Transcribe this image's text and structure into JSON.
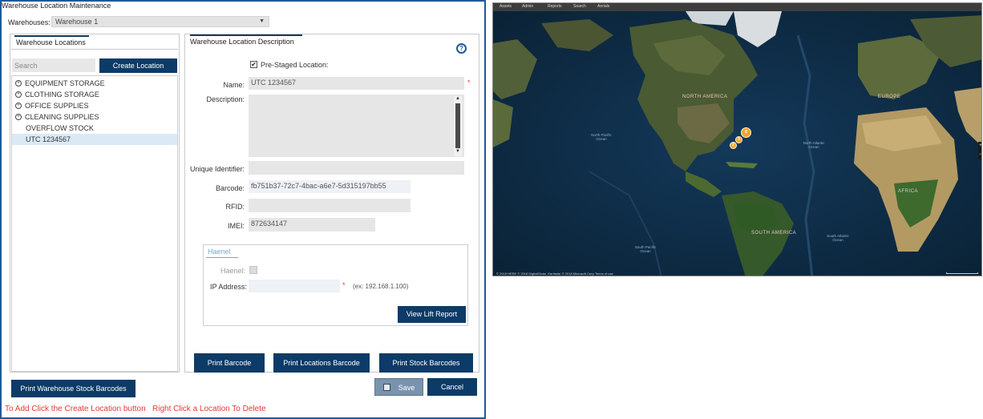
{
  "dialog": {
    "title": "Warehouse Location Maintenance",
    "warehouses_label": "Warehouses:",
    "warehouse_selected": "Warehouse 1",
    "left_tab": "Warehouse Locations",
    "search_placeholder": "Search",
    "create_location": "Create Location",
    "locations": [
      {
        "label": "EQUIPMENT STORAGE",
        "expandable": true
      },
      {
        "label": "CLOTHING STORAGE",
        "expandable": true
      },
      {
        "label": "OFFICE SUPPLIES",
        "expandable": true
      },
      {
        "label": "CLEANING SUPPLIES",
        "expandable": true
      },
      {
        "label": "OVERFLOW STOCK",
        "expandable": false
      },
      {
        "label": "UTC 1234567",
        "expandable": false,
        "selected": true
      }
    ],
    "right_tab": "Warehouse Location Description",
    "help_icon": "?",
    "prestaged_label": "Pre-Staged Location:",
    "prestaged_checked": "✔",
    "name_label": "Name:",
    "name_value": "UTC 1234567",
    "required_mark": "*",
    "description_label": "Description:",
    "description_value": "",
    "unique_id_label": "Unique Identifier:",
    "unique_id_value": "",
    "barcode_label": "Barcode:",
    "barcode_value": "fb751b37-72c7-4bac-a6e7-5d315197bb55",
    "rfid_label": "RFID:",
    "rfid_value": "",
    "imei_label": "IMEI:",
    "imei_value": "872634147",
    "haenel_tab": "Haenel",
    "haenel_label": "Haenel:",
    "ip_label": "IP Address:",
    "ip_value": "",
    "ip_hint": "(ex: 192.168.1.100)",
    "view_lift_report": "View Lift Report",
    "print_barcode": "Print Barcode",
    "print_locations_barcode": "Print Locations Barcode",
    "print_stock_barcodes": "Print Stock Barcodes",
    "print_warehouse_stock_barcodes": "Print Warehouse Stock Barcodes",
    "save": "Save",
    "cancel": "Cancel",
    "bottom_message": "To Add Click the Create Location button   Right Click a Location To Delete"
  },
  "map": {
    "nav": [
      "Assets",
      "Admin",
      "Reports",
      "Search",
      "Aerials"
    ],
    "continents": [
      "NORTH AMERICA",
      "SOUTH AMERICA",
      "EUROPE",
      "AFRICA"
    ],
    "oceans": [
      "North Pacific Ocean",
      "North Atlantic Ocean",
      "South Pacific Ocean",
      "South Atlantic Ocean"
    ],
    "cluster_values": [
      "8",
      "3",
      "2"
    ],
    "footer": "© 2018 HERE © 2018 DigitalGlobe, Earthstar © 2018 Microsoft Corp Terms of use",
    "zoom_in": "+",
    "zoom_out": "−"
  }
}
